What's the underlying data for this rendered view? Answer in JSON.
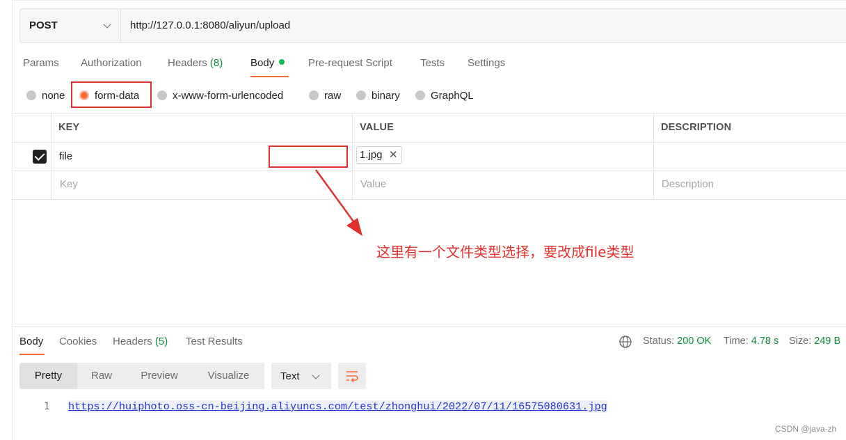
{
  "request": {
    "method": "POST",
    "url": "http://127.0.0.1:8080/aliyun/upload",
    "tabs": [
      {
        "label": "Params",
        "count": ""
      },
      {
        "label": "Authorization",
        "count": ""
      },
      {
        "label": "Headers",
        "count": "(8)"
      },
      {
        "label": "Body",
        "count": ""
      },
      {
        "label": "Pre-request Script",
        "count": ""
      },
      {
        "label": "Tests",
        "count": ""
      },
      {
        "label": "Settings",
        "count": ""
      }
    ],
    "body_modes": [
      "none",
      "form-data",
      "x-www-form-urlencoded",
      "raw",
      "binary",
      "GraphQL"
    ],
    "selected_body_mode": "form-data"
  },
  "table": {
    "headers": [
      "KEY",
      "VALUE",
      "DESCRIPTION"
    ],
    "rows": [
      {
        "checked": true,
        "key": "file",
        "value": "1.jpg",
        "description": ""
      }
    ],
    "placeholders": {
      "key": "Key",
      "value": "Value",
      "description": "Description"
    }
  },
  "annotation": "这里有一个文件类型选择，要改成file类型",
  "response": {
    "tabs": [
      {
        "label": "Body",
        "count": ""
      },
      {
        "label": "Cookies",
        "count": ""
      },
      {
        "label": "Headers",
        "count": "(5)"
      },
      {
        "label": "Test Results",
        "count": ""
      }
    ],
    "status_label": "Status:",
    "status_value": "200 OK",
    "time_label": "Time:",
    "time_value": "4.78 s",
    "size_label": "Size:",
    "size_value": "249 B",
    "view_modes": [
      "Pretty",
      "Raw",
      "Preview",
      "Visualize"
    ],
    "format": "Text",
    "line_number": "1",
    "body_text": "https://huiphoto.oss-cn-beijing.aliyuncs.com/test/zhonghui/2022/07/11/16575080631.jpg"
  },
  "watermark": "CSDN @java-zh",
  "colors": {
    "accent": "#ff6c37",
    "annotation": "#e0312e",
    "success": "#0f8a3a",
    "link": "#2036d4"
  },
  "icons": [
    "chevron-down-icon",
    "checkbox-checked-icon",
    "close-icon",
    "globe-icon",
    "wrap-lines-icon",
    "arrow-annotation"
  ]
}
